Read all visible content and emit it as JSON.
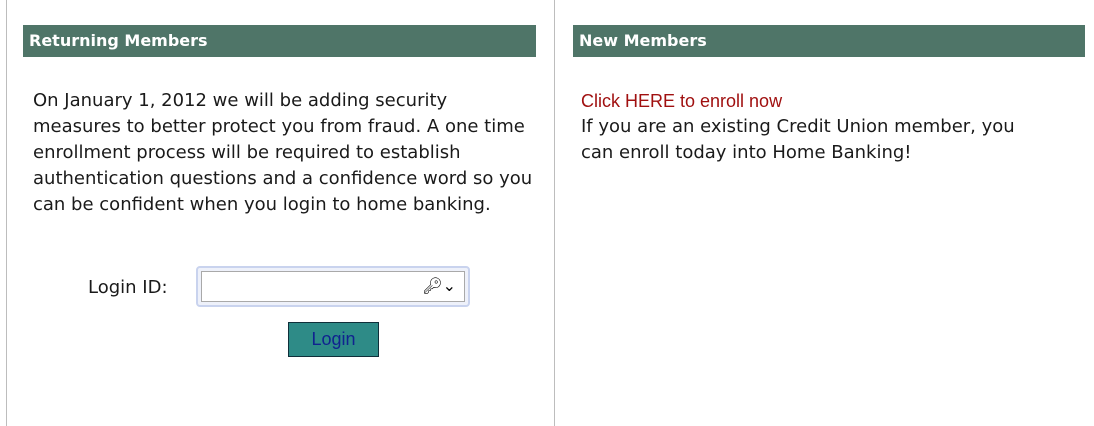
{
  "returning": {
    "header": "Returning Members",
    "notice": "On January 1, 2012 we will be adding security measures to better protect you from fraud. A one time enrollment process will be required to establish authentication questions and a confidence word so you can be confident when you login to home banking.",
    "login_label": "Login ID:",
    "login_value": "",
    "login_button": "Login",
    "key_icon": "key-icon"
  },
  "new_members": {
    "header": "New Members",
    "enroll_link": "Click HERE to enroll now",
    "enroll_text": "If you are an existing Credit Union member, you can enroll today into Home Banking!"
  },
  "colors": {
    "header_bg": "#4f7568",
    "link": "#a01010",
    "button_bg": "#2e8b87",
    "button_text": "#10238f"
  }
}
